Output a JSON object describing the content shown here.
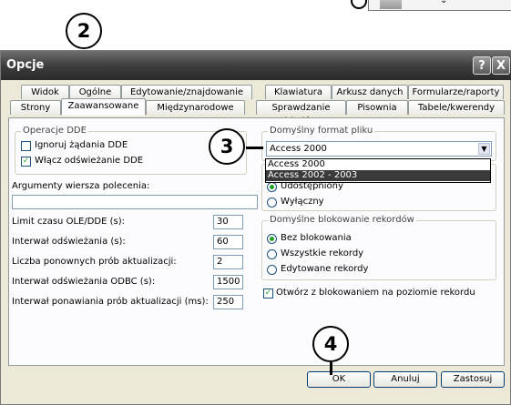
{
  "callouts": {
    "c2": "2",
    "c3": "3",
    "c4": "4"
  },
  "fragment_icon": "chevron-double-down-icon",
  "window": {
    "title": "Opcje",
    "help_label": "?",
    "close_label": "X"
  },
  "tabs_row1": [
    "Widok",
    "Ogólne",
    "Edytowanie/znajdowanie",
    "Klawiatura",
    "Arkusz danych",
    "Formularze/raporty"
  ],
  "tabs_row2": [
    "Strony",
    "Zaawansowane",
    "Międzynarodowe",
    "Sprawdzanie błędów",
    "Pisownia",
    "Tabele/kwerendy"
  ],
  "dde": {
    "group_title": "Operacje DDE",
    "ignore_label": "Ignoruj żądania DDE",
    "ignore_checked": false,
    "refresh_label": "Włącz odświeżanie DDE",
    "refresh_checked": true
  },
  "cmdline": {
    "label": "Argumenty wiersza polecenia:",
    "value": ""
  },
  "numeric_fields": [
    {
      "label": "Limit czasu OLE/DDE (s):",
      "value": "30"
    },
    {
      "label": "Interwał odświeżania (s):",
      "value": "60"
    },
    {
      "label": "Liczba ponownych prób aktualizacji:",
      "value": "2"
    },
    {
      "label": "Interwał odświeżania ODBC (s):",
      "value": "1500"
    },
    {
      "label": "Interwał ponawiania prób aktualizacji (ms):",
      "value": "250"
    }
  ],
  "file_format": {
    "group_title": "Domyślny format pliku",
    "selected": "Access 2000",
    "options": [
      "Access 2000",
      "Access 2002 - 2003"
    ],
    "highlighted": "Access 2002 - 2003"
  },
  "open_mode": {
    "options": [
      "Udostępniony",
      "Wyłączny"
    ],
    "selected": "Udostępniony"
  },
  "record_locking": {
    "group_title": "Domyślne blokowanie rekordów",
    "options": [
      "Bez blokowania",
      "Wszystkie rekordy",
      "Edytowane rekordy"
    ],
    "selected": "Bez blokowania"
  },
  "row_level_locking": {
    "label": "Otwórz z blokowaniem na poziomie rekordu",
    "checked": true
  },
  "buttons": {
    "ok": "OK",
    "cancel": "Anuluj",
    "apply": "Zastosuj"
  }
}
